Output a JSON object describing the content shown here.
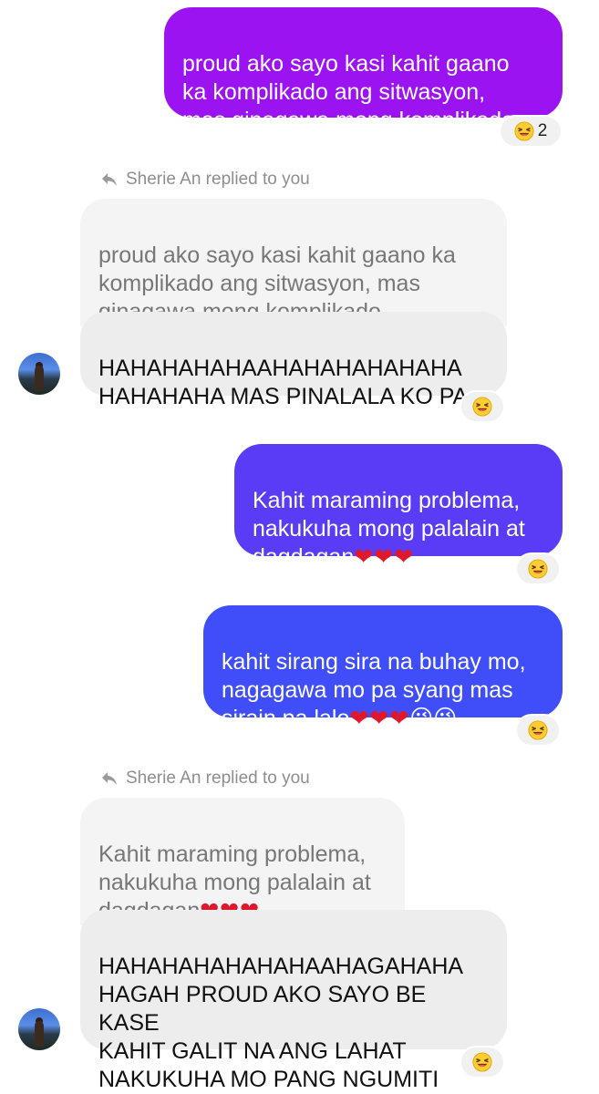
{
  "chat": {
    "messages": [
      {
        "id": "m1",
        "text": "proud ako sayo kasi kahit gaano\nka komplikado ang sitwasyon,\nmas ginagawa mong komplikado",
        "reaction_count": "2"
      },
      {
        "id": "m2",
        "reply_note": "Sherie An replied to you",
        "quoted_text": "proud ako sayo kasi kahit gaano ka\nkomplikado ang sitwasyon, mas\nginagawa mong komplikado",
        "text": "HAHAHAHAHAAHAHAHAHAHAHA\nHAHAHAHA MAS PINALALA KO PA"
      },
      {
        "id": "m3",
        "text": "Kahit maraming problema,\nnakukuha mong palalain at\ndagdagan",
        "hearts": "❤❤❤"
      },
      {
        "id": "m4",
        "text": "kahit sirang sira na buhay mo,\nnagagawa mo pa syang mas\nsirain pa lalo",
        "hearts": "❤❤❤",
        "kiss_emojis": "😘😘"
      },
      {
        "id": "m5",
        "reply_note": "Sherie An replied to you",
        "quoted_text": "Kahit maraming problema,\nnakukuha mong palalain at\ndagdagan",
        "quoted_hearts": "❤❤❤",
        "text": "HAHAHAHAHAHAHAAHAGAHAHA\nHAGAH PROUD AKO SAYO BE KASE\nKAHIT GALIT NA ANG LAHAT\nNAKUKUHA MO PANG NGUMITI"
      }
    ]
  },
  "colors": {
    "sent_purple": "#9a13f0",
    "sent_indigo": "#5a3cf6",
    "sent_blue": "#3f4ef8",
    "heart_red": "#e0182d",
    "reaction_emoji": "#ffcc33"
  },
  "icons": {
    "reply": "reply-arrow-icon",
    "reaction": "laughing-emoji-icon",
    "avatar": "contact-avatar"
  }
}
